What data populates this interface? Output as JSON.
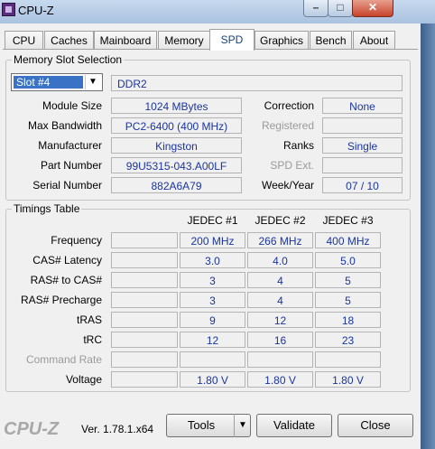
{
  "window": {
    "title": "CPU-Z"
  },
  "tabs": [
    "CPU",
    "Caches",
    "Mainboard",
    "Memory",
    "SPD",
    "Graphics",
    "Bench",
    "About"
  ],
  "active_tab": "SPD",
  "slot_section": {
    "title": "Memory Slot Selection",
    "slot_value": "Slot #4",
    "memory_type": "DDR2",
    "module_size_label": "Module Size",
    "module_size": "1024 MBytes",
    "max_bandwidth_label": "Max Bandwidth",
    "max_bandwidth": "PC2-6400 (400 MHz)",
    "manufacturer_label": "Manufacturer",
    "manufacturer": "Kingston",
    "part_number_label": "Part Number",
    "part_number": "99U5315-043.A00LF",
    "serial_number_label": "Serial Number",
    "serial_number": "882A6A79",
    "correction_label": "Correction",
    "correction": "None",
    "registered_label": "Registered",
    "registered": "",
    "ranks_label": "Ranks",
    "ranks": "Single",
    "spd_ext_label": "SPD Ext.",
    "spd_ext": "",
    "week_year_label": "Week/Year",
    "week_year": "07 / 10"
  },
  "timings": {
    "title": "Timings Table",
    "headers": [
      "JEDEC #1",
      "JEDEC #2",
      "JEDEC #3"
    ],
    "rows": [
      {
        "label": "Frequency",
        "values": [
          "200 MHz",
          "266 MHz",
          "400 MHz"
        ]
      },
      {
        "label": "CAS# Latency",
        "values": [
          "3.0",
          "4.0",
          "5.0"
        ]
      },
      {
        "label": "RAS# to CAS#",
        "values": [
          "3",
          "4",
          "5"
        ]
      },
      {
        "label": "RAS# Precharge",
        "values": [
          "3",
          "4",
          "5"
        ]
      },
      {
        "label": "tRAS",
        "values": [
          "9",
          "12",
          "18"
        ]
      },
      {
        "label": "tRC",
        "values": [
          "12",
          "16",
          "23"
        ]
      },
      {
        "label": "Command Rate",
        "values": [
          "",
          "",
          ""
        ]
      },
      {
        "label": "Voltage",
        "values": [
          "1.80 V",
          "1.80 V",
          "1.80 V"
        ]
      }
    ]
  },
  "footer": {
    "logo": "CPU-Z",
    "version": "Ver. 1.78.1.x64",
    "tools_label": "Tools",
    "validate_label": "Validate",
    "close_label": "Close"
  }
}
